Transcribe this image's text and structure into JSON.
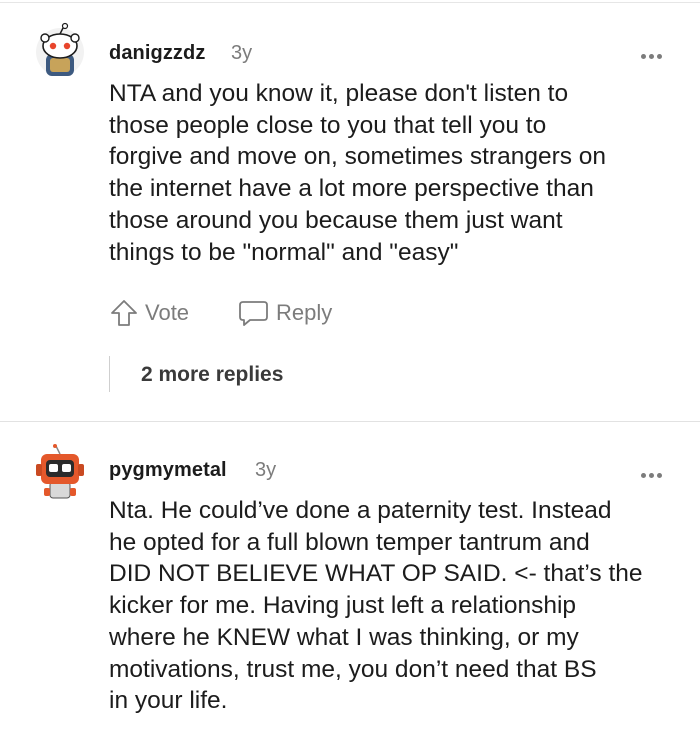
{
  "comments": [
    {
      "username": "danigzzdz",
      "age": "3y",
      "body": "NTA and you know it, please don't listen to\nthose people close to you that tell you to\nforgive and move on, sometimes strangers on\nthe internet have a lot more perspective than\nthose around you because them just want\nthings to be \"normal\" and \"easy\"",
      "vote_label": "Vote",
      "reply_label": "Reply",
      "more_replies": "2 more replies",
      "avatar_icon": "snoo-avatar-icon"
    },
    {
      "username": "pygmymetal",
      "age": "3y",
      "body": "Nta. He could’ve done a paternity test. Instead\nhe opted for a full blown temper tantrum and\nDID NOT BELIEVE WHAT OP SAID. <- that’s the\nkicker for me. Having just left a relationship\nwhere he KNEW what I was thinking, or my\nmotivations, trust me, you don’t need that BS\nin your life.",
      "avatar_icon": "robot-avatar-icon"
    }
  ],
  "colors": {
    "text": "#1c1c1c",
    "muted": "#7c7c7c",
    "divider": "#e2e2e2"
  }
}
